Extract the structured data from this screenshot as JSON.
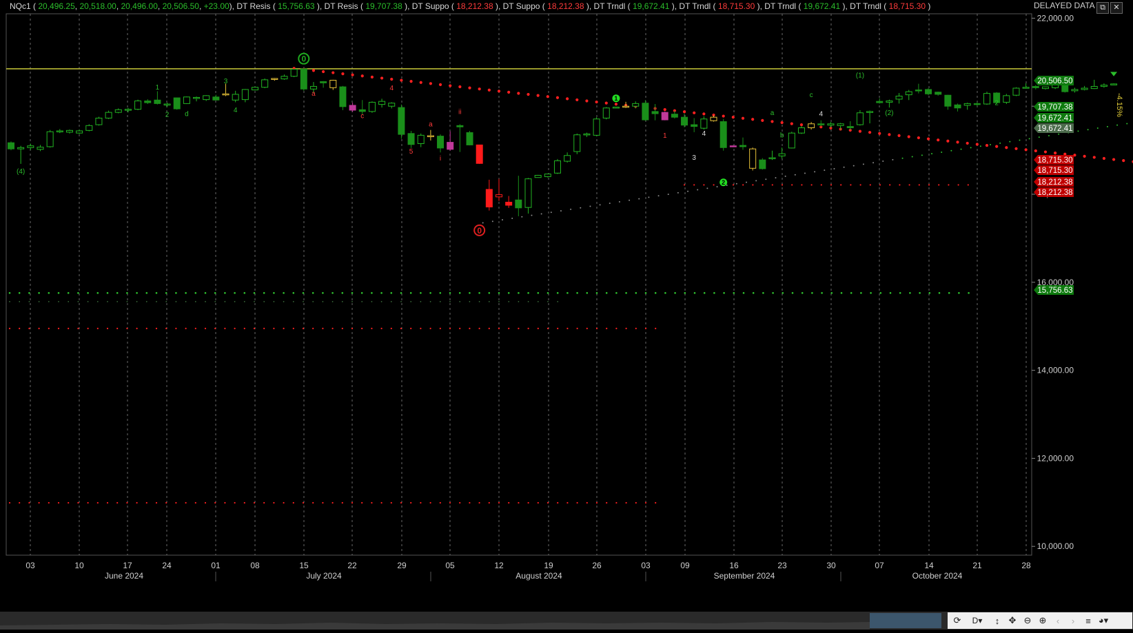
{
  "header": {
    "symbol": "NQc1",
    "ohlc": [
      "20,496.25",
      "20,518.00",
      "20,496.00",
      "20,506.50",
      "+23.00"
    ],
    "indicators": [
      {
        "name": "DT Resis",
        "value": "15,756.63",
        "color": "#2bbd2b"
      },
      {
        "name": "DT Resis",
        "value": "19,707.38",
        "color": "#2bbd2b"
      },
      {
        "name": "DT Suppo",
        "value": "18,212.38",
        "color": "#ff3b3b"
      },
      {
        "name": "DT Suppo",
        "value": "18,212.38",
        "color": "#ff3b3b"
      },
      {
        "name": "DT Trndl",
        "value": "19,672.41",
        "color": "#2bbd2b"
      },
      {
        "name": "DT Trndl",
        "value": "18,715.30",
        "color": "#ff3b3b"
      },
      {
        "name": "DT Trndl",
        "value": "19,672.41",
        "color": "#2bbd2b"
      },
      {
        "name": "DT Trndl",
        "value": "18,715.30",
        "color": "#ff3b3b"
      }
    ],
    "delayed_label": "DELAYED DATA"
  },
  "window_controls": {
    "restore_icon": "restore-icon",
    "close_icon": "close-icon",
    "restore_glyph": "⧉",
    "close_glyph": "✕"
  },
  "colors": {
    "up": "#22b522",
    "down": "#1a8f1a",
    "doji": "#e8c238",
    "magenta": "#c0399a",
    "red": "#ff1a1a",
    "level_line": "#c9c93a",
    "grid": "#6a6a6a",
    "support_dots": "#ff2020",
    "resist_dots": "#2fbf2f"
  },
  "chart_data": {
    "type": "candlestick",
    "ylim": [
      9800,
      22100
    ],
    "y_ticks": [
      "22,000.00",
      "20,000.00",
      "18,000.00",
      "16,000.00",
      "14,000.00",
      "12,000.00",
      "10,000.00"
    ],
    "y_tick_values": [
      22000,
      20000,
      18000,
      16000,
      14000,
      12000,
      10000
    ],
    "x_day_labels": [
      "03",
      "10",
      "17",
      "24",
      "01",
      "08",
      "15",
      "22",
      "29",
      "05",
      "12",
      "19",
      "26",
      "03",
      "09",
      "16",
      "23",
      "30",
      "07",
      "14",
      "21",
      "28"
    ],
    "x_month_labels": [
      "June 2024",
      "July 2024",
      "August 2024",
      "September 2024",
      "October 2024"
    ],
    "price_tags": [
      {
        "label": "20,506.50",
        "value": 20506.5,
        "color": "#0e7a0e"
      },
      {
        "label": "19,707.38",
        "value": 19707.38,
        "color": "#0e7a0e"
      },
      {
        "label": "19,672.41",
        "value": 19672.41,
        "color": "#0e7a0e"
      },
      {
        "label": "19,672.41",
        "value": 19672.41,
        "color": "#4c6b4c"
      },
      {
        "label": "18,715.30",
        "value": 18715.3,
        "color": "#c00000"
      },
      {
        "label": "18,715.30",
        "value": 18715.3,
        "color": "#c00000"
      },
      {
        "label": "18,212.38",
        "value": 18212.38,
        "color": "#c00000"
      },
      {
        "label": "18,212.38",
        "value": 18212.38,
        "color": "#c00000"
      },
      {
        "label": "15,756.63",
        "value": 15756.63,
        "color": "#0e7a0e"
      }
    ],
    "level_line": 20850,
    "percent_label": "-4.15%",
    "candles": [
      [
        19170,
        19200,
        19000,
        19030
      ],
      [
        19030,
        19100,
        18690,
        19060
      ],
      [
        19060,
        19150,
        19010,
        19100
      ],
      [
        19020,
        19120,
        18980,
        19070
      ],
      [
        19080,
        19460,
        19060,
        19420
      ],
      [
        19420,
        19480,
        19390,
        19440
      ],
      [
        19410,
        19470,
        19380,
        19450
      ],
      [
        19390,
        19470,
        19370,
        19440
      ],
      [
        19450,
        19590,
        19430,
        19560
      ],
      [
        19580,
        19760,
        19560,
        19730
      ],
      [
        19730,
        19900,
        19710,
        19860
      ],
      [
        19860,
        19950,
        19840,
        19920
      ],
      [
        19910,
        19960,
        19860,
        19930
      ],
      [
        19930,
        20150,
        19910,
        20120
      ],
      [
        20120,
        20160,
        20050,
        20080
      ],
      [
        20140,
        20340,
        20040,
        20060
      ],
      [
        20030,
        20080,
        19980,
        20050
      ],
      [
        20190,
        20190,
        19920,
        19940
      ],
      [
        20060,
        20220,
        20050,
        20210
      ],
      [
        20180,
        20220,
        20110,
        20200
      ],
      [
        20150,
        20250,
        20120,
        20240
      ],
      [
        20210,
        20260,
        20160,
        20140
      ],
      [
        20280,
        20510,
        20230,
        20260
      ],
      [
        20140,
        20350,
        20090,
        20270
      ],
      [
        20150,
        20390,
        20090,
        20380
      ],
      [
        20370,
        20440,
        20360,
        20430
      ],
      [
        20430,
        20630,
        20410,
        20600
      ],
      [
        20610,
        20640,
        20580,
        20630
      ],
      [
        20620,
        20720,
        20600,
        20680
      ],
      [
        20680,
        20850,
        20660,
        20840
      ],
      [
        20850,
        20850,
        20350,
        20390
      ],
      [
        20390,
        20550,
        20300,
        20450
      ],
      [
        20560,
        20570,
        20420,
        20530
      ],
      [
        20590,
        20600,
        20370,
        20420
      ],
      [
        20440,
        20460,
        19910,
        19990
      ],
      [
        20020,
        20080,
        19870,
        19910
      ],
      [
        19920,
        20140,
        19800,
        19880
      ],
      [
        19880,
        20110,
        19850,
        20090
      ],
      [
        20040,
        20170,
        19970,
        20110
      ],
      [
        20000,
        20090,
        19950,
        20070
      ],
      [
        19970,
        20040,
        19260,
        19360
      ],
      [
        19380,
        19440,
        19050,
        19130
      ],
      [
        19150,
        19380,
        19070,
        19340
      ],
      [
        19330,
        19460,
        19220,
        19310
      ],
      [
        19320,
        19360,
        18950,
        19050
      ],
      [
        19180,
        19430,
        18990,
        19020
      ],
      [
        19560,
        19590,
        18960,
        19530
      ],
      [
        19400,
        19440,
        19110,
        19120
      ],
      [
        19120,
        19120,
        18690,
        18700
      ],
      [
        18110,
        18330,
        17630,
        17710
      ],
      [
        17940,
        18350,
        17850,
        17990
      ],
      [
        17820,
        17960,
        17690,
        17750
      ],
      [
        17870,
        18420,
        17500,
        17690
      ],
      [
        17700,
        18370,
        17560,
        18350
      ],
      [
        18380,
        18440,
        18380,
        18430
      ],
      [
        18400,
        18470,
        18380,
        18460
      ],
      [
        18480,
        18800,
        18460,
        18760
      ],
      [
        18750,
        18950,
        18720,
        18880
      ],
      [
        18970,
        19380,
        18910,
        19350
      ],
      [
        19350,
        19400,
        19300,
        19370
      ],
      [
        19340,
        19750,
        19320,
        19710
      ],
      [
        19730,
        19980,
        19700,
        19960
      ],
      [
        19970,
        19980,
        19950,
        19980
      ],
      [
        20000,
        20100,
        19960,
        19980
      ],
      [
        20000,
        20110,
        19950,
        20060
      ],
      [
        20070,
        20140,
        19670,
        19690
      ],
      [
        19880,
        20050,
        19680,
        19830
      ],
      [
        19860,
        19880,
        19680,
        19690
      ],
      [
        19820,
        19900,
        19720,
        19750
      ],
      [
        19750,
        19830,
        19520,
        19570
      ],
      [
        19580,
        19730,
        19410,
        19540
      ],
      [
        19500,
        19770,
        19470,
        19710
      ],
      [
        19750,
        19790,
        19650,
        19670
      ],
      [
        19650,
        19710,
        18990,
        19060
      ],
      [
        19100,
        19110,
        19070,
        19080
      ],
      [
        19110,
        19290,
        19010,
        19080
      ],
      [
        19030,
        19060,
        18540,
        18590
      ],
      [
        18780,
        18820,
        18560,
        18580
      ],
      [
        18810,
        18990,
        18780,
        18830
      ],
      [
        18870,
        19060,
        18810,
        18920
      ],
      [
        19050,
        19420,
        19040,
        19390
      ],
      [
        19390,
        19550,
        19370,
        19510
      ],
      [
        19510,
        19640,
        19470,
        19600
      ],
      [
        19600,
        19680,
        19540,
        19590
      ],
      [
        19570,
        19640,
        19510,
        19600
      ],
      [
        19560,
        19620,
        19460,
        19600
      ],
      [
        19540,
        19660,
        19460,
        19510
      ],
      [
        19580,
        19910,
        19560,
        19850
      ],
      [
        19860,
        19900,
        19610,
        19880
      ],
      [
        20110,
        20180,
        20060,
        20080
      ],
      [
        20090,
        20150,
        19970,
        20120
      ],
      [
        20160,
        20300,
        20060,
        20230
      ],
      [
        20260,
        20370,
        20140,
        20330
      ],
      [
        20370,
        20510,
        20290,
        20360
      ],
      [
        20380,
        20410,
        20250,
        20280
      ],
      [
        20320,
        20330,
        20240,
        20270
      ],
      [
        20250,
        20260,
        19920,
        20000
      ],
      [
        20030,
        20060,
        19880,
        19960
      ],
      [
        20020,
        20080,
        19920,
        20060
      ],
      [
        20060,
        20090,
        20000,
        20040
      ],
      [
        20050,
        20330,
        20030,
        20290
      ],
      [
        20300,
        20320,
        20050,
        20080
      ],
      [
        20090,
        20280,
        20050,
        20240
      ],
      [
        20250,
        20430,
        20230,
        20410
      ],
      [
        20410,
        20520,
        20400,
        20430
      ],
      [
        20450,
        20480,
        20380,
        20420
      ],
      [
        20400,
        20450,
        20380,
        20440
      ],
      [
        20420,
        20630,
        20390,
        20580
      ],
      [
        20600,
        20610,
        20310,
        20330
      ],
      [
        20350,
        20420,
        20310,
        20380
      ],
      [
        20380,
        20460,
        20360,
        20410
      ],
      [
        20400,
        20600,
        20390,
        20450
      ],
      [
        20450,
        20520,
        20420,
        20480
      ],
      [
        20496.25,
        20518.0,
        20496.0,
        20506.5
      ]
    ],
    "markers": [
      {
        "text": "0",
        "index": 30,
        "value": 21080,
        "type": "circle-green"
      },
      {
        "text": "0",
        "index": 48,
        "value": 17180,
        "type": "circle-red"
      },
      {
        "text": "1",
        "index": 62,
        "value": 20180,
        "type": "dot-green"
      },
      {
        "text": "2",
        "index": 73,
        "value": 18270,
        "type": "dot-green"
      },
      {
        "text": "(4)",
        "index": 1,
        "value": 18470,
        "color": "#2bbd2b"
      },
      {
        "text": "1",
        "index": 15,
        "value": 20380,
        "color": "#2bbd2b"
      },
      {
        "text": "2",
        "index": 16,
        "value": 19760,
        "color": "#2bbd2b"
      },
      {
        "text": "d",
        "index": 18,
        "value": 19780,
        "color": "#2bbd2b"
      },
      {
        "text": "3",
        "index": 22,
        "value": 20520,
        "color": "#2bbd2b"
      },
      {
        "text": "4",
        "index": 23,
        "value": 19860,
        "color": "#2bbd2b"
      },
      {
        "text": "a",
        "index": 31,
        "value": 20240,
        "color": "#ff3b3b"
      },
      {
        "text": "c",
        "index": 36,
        "value": 19730,
        "color": "#ff3b3b"
      },
      {
        "text": "4",
        "index": 39,
        "value": 20360,
        "color": "#ff3b3b"
      },
      {
        "text": "5",
        "index": 41,
        "value": 18920,
        "color": "#ff3b3b"
      },
      {
        "text": "a",
        "index": 43,
        "value": 19540,
        "color": "#ff3b3b"
      },
      {
        "text": "i",
        "index": 44,
        "value": 18770,
        "color": "#ff3b3b"
      },
      {
        "text": "ii",
        "index": 46,
        "value": 19820,
        "color": "#ff3b3b"
      },
      {
        "text": "1",
        "index": 67,
        "value": 19280,
        "color": "#ff3b3b"
      },
      {
        "text": "4",
        "index": 71,
        "value": 19330,
        "color": "#e0e0e0"
      },
      {
        "text": "3",
        "index": 70,
        "value": 18780,
        "color": "#e0e0e0"
      },
      {
        "text": "a",
        "index": 78,
        "value": 19800,
        "color": "#2bbd2b"
      },
      {
        "text": "b",
        "index": 79,
        "value": 19290,
        "color": "#2bbd2b"
      },
      {
        "text": "c",
        "index": 82,
        "value": 20210,
        "color": "#2bbd2b"
      },
      {
        "text": "4",
        "index": 83,
        "value": 19780,
        "color": "#e0e0e0"
      },
      {
        "text": "(1)",
        "index": 87,
        "value": 20650,
        "color": "#2bbd2b"
      },
      {
        "text": "(2)",
        "index": 90,
        "value": 19800,
        "color": "#2bbd2b"
      },
      {
        "text": "2",
        "index": 101,
        "value": 20030,
        "color": "#2bbd2b"
      }
    ]
  },
  "toolbar": {
    "refresh_icon": "refresh-icon",
    "period_label": "D",
    "autoscale_icon": "vertical-resize-icon",
    "pan_icon": "move-icon",
    "zoom_out_icon": "zoom-out-icon",
    "zoom_in_icon": "zoom-in-icon",
    "back_icon": "chevron-left-icon",
    "forward_icon": "chevron-right-icon",
    "menu_icon": "menu-icon",
    "palette_icon": "palette-icon"
  }
}
